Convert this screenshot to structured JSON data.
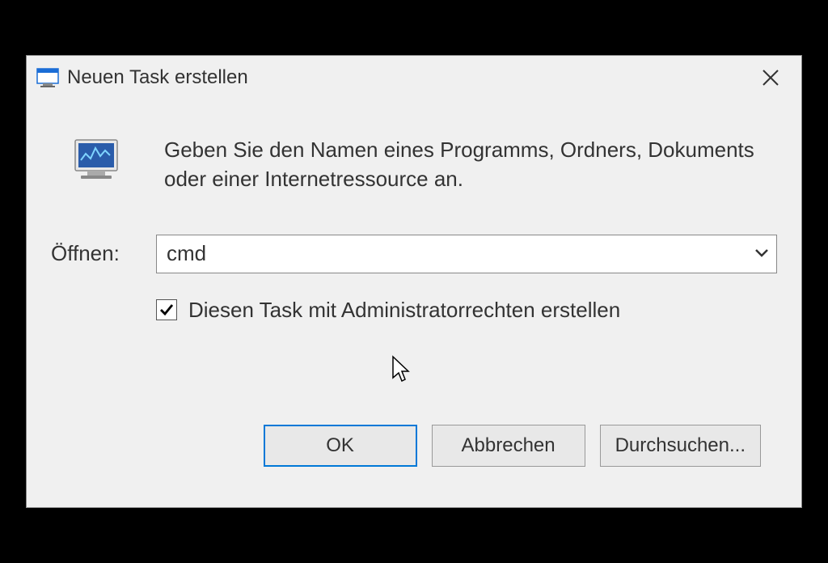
{
  "dialog": {
    "title": "Neuen Task erstellen",
    "info_text": "Geben Sie den Namen eines Programms, Ordners, Dokuments oder einer Internetressource an.",
    "input_label": "Öffnen:",
    "input_value": "cmd",
    "checkbox_label": "Diesen Task mit Administratorrechten erstellen",
    "checkbox_checked": true,
    "buttons": {
      "ok": "OK",
      "cancel": "Abbrechen",
      "browse": "Durchsuchen..."
    }
  }
}
